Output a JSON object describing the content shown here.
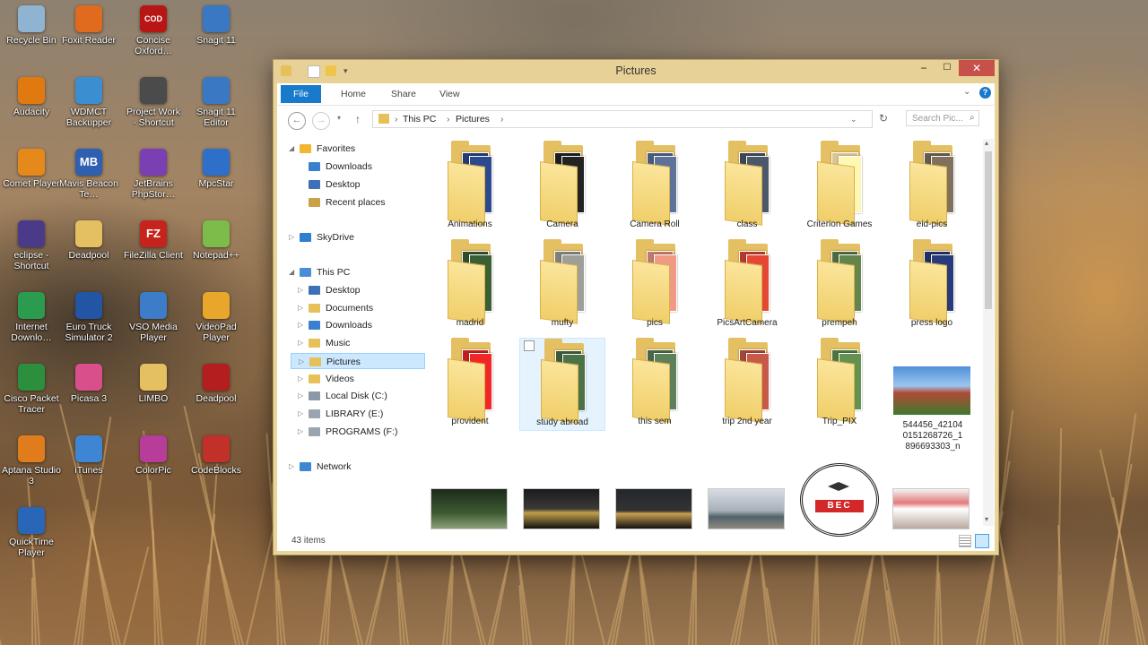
{
  "desktop": {
    "icons": [
      {
        "label": "Recycle Bin",
        "icon": "recycle-bin-icon",
        "color": "#8fb4d2"
      },
      {
        "label": "Foxit Reader",
        "icon": "foxit-reader-icon",
        "color": "#e06a1e"
      },
      {
        "label": "Concise Oxford…",
        "icon": "oxford-dictionary-icon",
        "color": "#b81515",
        "text": "COD"
      },
      {
        "label": "Snagit 11",
        "icon": "snagit-icon",
        "color": "#3a78c4"
      },
      {
        "label": "Audacity",
        "icon": "audacity-icon",
        "color": "#e07a10"
      },
      {
        "label": "WDMCT Backupper",
        "icon": "backupper-icon",
        "color": "#3b8fd1"
      },
      {
        "label": "Project Work - Shortcut",
        "icon": "project-shortcut-icon",
        "color": "#4b4b4b"
      },
      {
        "label": "Snagit 11 Editor",
        "icon": "snagit-editor-icon",
        "color": "#3a78c4"
      },
      {
        "label": "Comet Player",
        "icon": "comet-player-icon",
        "color": "#e58a1a"
      },
      {
        "label": "Mavis Beacon Te…",
        "icon": "mavis-beacon-icon",
        "color": "#2e5fb0",
        "text": "MB"
      },
      {
        "label": "JetBrains PhpStor…",
        "icon": "phpstorm-icon",
        "color": "#7a3fb2"
      },
      {
        "label": "MpcStar",
        "icon": "mpcstar-icon",
        "color": "#2d6fc9"
      },
      {
        "label": "eclipse - Shortcut",
        "icon": "eclipse-icon",
        "color": "#4b3a8a"
      },
      {
        "label": "Deadpool",
        "icon": "deadpool-folder-icon",
        "color": "#e5c062"
      },
      {
        "label": "FileZilla Client",
        "icon": "filezilla-icon",
        "color": "#c6231d",
        "text": "FZ"
      },
      {
        "label": "Notepad++",
        "icon": "notepad-plus-icon",
        "color": "#7dbb4a"
      },
      {
        "label": "Internet Downlo…",
        "icon": "internet-download-manager-icon",
        "color": "#2b9b4f"
      },
      {
        "label": "Euro Truck Simulator 2",
        "icon": "euro-truck-icon",
        "color": "#2255a4"
      },
      {
        "label": "VSO Media Player",
        "icon": "vso-media-player-icon",
        "color": "#3d7cc9"
      },
      {
        "label": "VideoPad Player",
        "icon": "videopad-icon",
        "color": "#e8a62a"
      },
      {
        "label": "Cisco Packet Tracer",
        "icon": "cisco-packet-tracer-icon",
        "color": "#2c8f3e"
      },
      {
        "label": "Picasa 3",
        "icon": "picasa-icon",
        "color": "#d94f8b"
      },
      {
        "label": "LIMBO",
        "icon": "limbo-folder-icon",
        "color": "#e5c062"
      },
      {
        "label": "Deadpool",
        "icon": "deadpool-game-icon",
        "color": "#b41e1e"
      },
      {
        "label": "Aptana Studio 3",
        "icon": "aptana-icon",
        "color": "#e07c1c"
      },
      {
        "label": "iTunes",
        "icon": "itunes-icon",
        "color": "#3e86d3"
      },
      {
        "label": "ColorPic",
        "icon": "colorpic-icon",
        "color": "#b83c9a"
      },
      {
        "label": "CodeBlocks",
        "icon": "codeblocks-icon",
        "color": "#c2302a"
      },
      {
        "label": "QuickTime Player",
        "icon": "quicktime-icon",
        "color": "#2a66b8"
      }
    ]
  },
  "window": {
    "title": "Pictures",
    "minimize": "−",
    "maximize": "☐",
    "close": "✕",
    "ribbon_tabs": [
      "File",
      "Home",
      "Share",
      "View"
    ],
    "address": {
      "root": "This PC",
      "folder": "Pictures",
      "sep": "›"
    },
    "search_placeholder": "Search Pic...",
    "nav": {
      "favorites": "Favorites",
      "fav_items": [
        "Downloads",
        "Desktop",
        "Recent places"
      ],
      "skydrive": "SkyDrive",
      "this_pc": "This PC",
      "pc_items": [
        "Desktop",
        "Documents",
        "Downloads",
        "Music",
        "Pictures",
        "Videos",
        "Local Disk (C:)",
        "LIBRARY (E:)",
        "PROGRAMS (F:)"
      ],
      "network": "Network"
    },
    "folders": [
      {
        "name": "Animations",
        "color": "#233a72"
      },
      {
        "name": "Camera",
        "color": "#1c1c1c"
      },
      {
        "name": "Camera Roll",
        "color": "#4b5b7a"
      },
      {
        "name": "class",
        "color": "#3c4654"
      },
      {
        "name": "Criterion Games",
        "color": "#d8c690"
      },
      {
        "name": "eid-pics",
        "color": "#665a4a"
      },
      {
        "name": "madrid",
        "color": "#2f4c2a"
      },
      {
        "name": "mufty",
        "color": "#7e7f7a"
      },
      {
        "name": "pics",
        "color": "#c07a6a"
      },
      {
        "name": "PicsArtCamera",
        "color": "#b63a2a"
      },
      {
        "name": "prempeh",
        "color": "#4f6a3c"
      },
      {
        "name": "press logo",
        "color": "#1f2e62"
      },
      {
        "name": "provident",
        "color": "#c11f1f"
      },
      {
        "name": "study abroad",
        "color": "#3d5b3a"
      },
      {
        "name": "this sem",
        "color": "#4b6646"
      },
      {
        "name": "trip 2nd year",
        "color": "#a0463a"
      },
      {
        "name": "Trip_PIX",
        "color": "#4f7440"
      }
    ],
    "photo_file": "544456_421040151268726_1896693303_n",
    "bec_logo_text": "BEC",
    "status": "43 items"
  }
}
